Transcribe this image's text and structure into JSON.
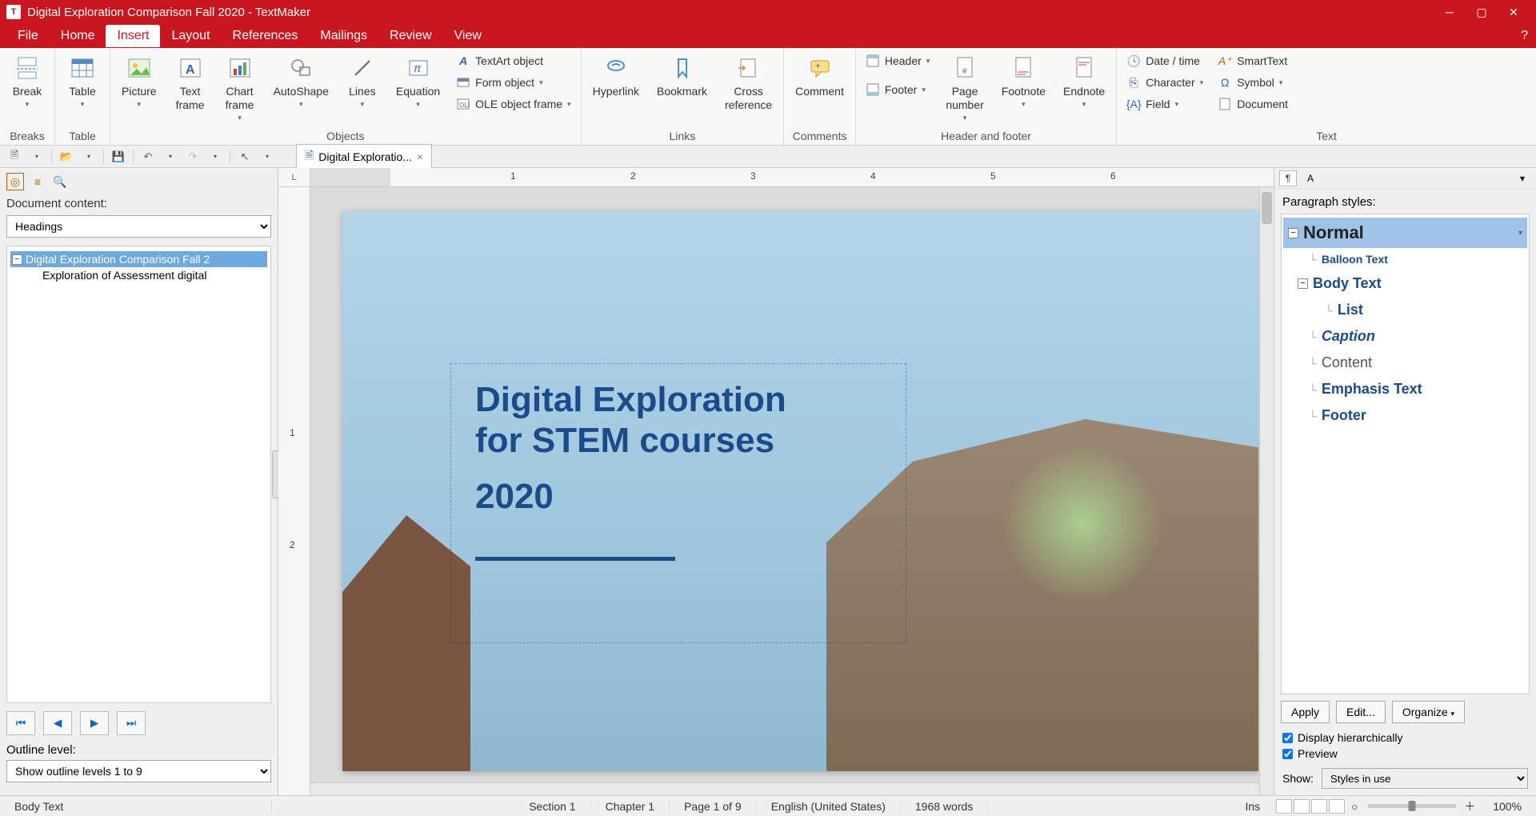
{
  "titlebar": {
    "app_icon": "T",
    "title": "Digital Exploration Comparison Fall 2020 - TextMaker"
  },
  "menu": {
    "items": [
      "File",
      "Home",
      "Insert",
      "Layout",
      "References",
      "Mailings",
      "Review",
      "View"
    ],
    "active": "Insert"
  },
  "ribbon": {
    "breaks": {
      "break": "Break",
      "table": "Table",
      "group": "Breaks"
    },
    "tablegrp": {
      "group": "Table"
    },
    "objects": {
      "picture": "Picture",
      "textframe": "Text\nframe",
      "chartframe": "Chart\nframe",
      "autoshape": "AutoShape",
      "lines": "Lines",
      "equation": "Equation",
      "textart": "TextArt object",
      "formobj": "Form object",
      "oleframe": "OLE object frame",
      "group": "Objects"
    },
    "links": {
      "hyperlink": "Hyperlink",
      "bookmark": "Bookmark",
      "crossref": "Cross\nreference",
      "group": "Links"
    },
    "comments": {
      "comment": "Comment",
      "group": "Comments"
    },
    "hf": {
      "header": "Header",
      "footer": "Footer",
      "pagenum": "Page\nnumber",
      "footnote": "Footnote",
      "endnote": "Endnote",
      "group": "Header and footer"
    },
    "text": {
      "datetime": "Date / time",
      "smarttext": "SmartText",
      "character": "Character",
      "symbol": "Symbol",
      "field": "Field",
      "document": "Document",
      "group": "Text"
    }
  },
  "doctab": {
    "label": "Digital Exploratio..."
  },
  "left_panel": {
    "title": "Document content:",
    "mode": "Headings",
    "tree_root": "Digital Exploration Comparison Fall 2",
    "tree_child": "Exploration of Assessment digital",
    "outline_label": "Outline level:",
    "outline_value": "Show outline levels 1 to 9"
  },
  "ruler": {
    "nums": [
      "1",
      "2",
      "3",
      "4",
      "5",
      "6"
    ]
  },
  "vruler": {
    "nums": [
      "1",
      "2"
    ]
  },
  "doc": {
    "h1_line1": "Digital Exploration",
    "h1_line2": "for STEM courses",
    "year": "2020"
  },
  "right_panel": {
    "title": "Paragraph styles:",
    "styles": {
      "normal": "Normal",
      "balloon": "Balloon Text",
      "body": "Body Text",
      "list": "List",
      "caption": "Caption",
      "content": "Content",
      "emphasis": "Emphasis Text",
      "footer": "Footer"
    },
    "apply": "Apply",
    "edit": "Edit...",
    "organize": "Organize",
    "chk_hier": "Display hierarchically",
    "chk_prev": "Preview",
    "show_label": "Show:",
    "show_value": "Styles in use"
  },
  "status": {
    "style": "Body Text",
    "section": "Section 1",
    "chapter": "Chapter 1",
    "page": "Page 1 of 9",
    "lang": "English (United States)",
    "words": "1968 words",
    "ins": "Ins",
    "zoom": "100%"
  }
}
